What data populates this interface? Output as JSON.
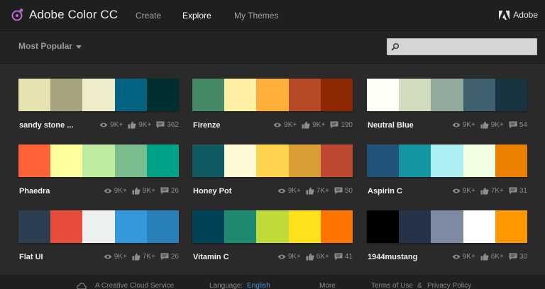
{
  "header": {
    "logo_text": "Adobe Color CC",
    "nav": [
      {
        "label": "Create",
        "active": false
      },
      {
        "label": "Explore",
        "active": true
      },
      {
        "label": "My Themes",
        "active": false
      }
    ],
    "brand_text": "Adobe"
  },
  "toolbar": {
    "filter_label": "Most Popular",
    "search_placeholder": "",
    "search_value": ""
  },
  "themes": [
    {
      "name": "sandy stone ...",
      "views": "9K+",
      "likes": "9K+",
      "comments": "362",
      "colors": [
        "#E6E2AF",
        "#A7A37E",
        "#EFECCA",
        "#046380",
        "#002F2F"
      ]
    },
    {
      "name": "Firenze",
      "views": "9K+",
      "likes": "9K+",
      "comments": "190",
      "colors": [
        "#468966",
        "#FFF0A5",
        "#FFB03B",
        "#B64926",
        "#8E2800"
      ]
    },
    {
      "name": "Neutral Blue",
      "views": "9K+",
      "likes": "9K+",
      "comments": "54",
      "colors": [
        "#FCFFF5",
        "#D1DBBD",
        "#91AA9D",
        "#3E606F",
        "#193441"
      ]
    },
    {
      "name": "Phaedra",
      "views": "9K+",
      "likes": "9K+",
      "comments": "26",
      "colors": [
        "#FF6138",
        "#FFFF9D",
        "#BEEB9F",
        "#79BD8F",
        "#00A388"
      ]
    },
    {
      "name": "Honey Pot",
      "views": "9K+",
      "likes": "7K+",
      "comments": "50",
      "colors": [
        "#105B63",
        "#FFFAD5",
        "#FFD34E",
        "#DB9E36",
        "#BD4932"
      ]
    },
    {
      "name": "Aspirin C",
      "views": "9K+",
      "likes": "7K+",
      "comments": "31",
      "colors": [
        "#225378",
        "#1695A3",
        "#ACF0F2",
        "#F3FFE2",
        "#EB7F00"
      ]
    },
    {
      "name": "Flat UI",
      "views": "9K+",
      "likes": "7K+",
      "comments": "26",
      "colors": [
        "#2C3E50",
        "#E74C3C",
        "#ECF0F1",
        "#3498DB",
        "#2980B9"
      ]
    },
    {
      "name": "Vitamin C",
      "views": "9K+",
      "likes": "6K+",
      "comments": "41",
      "colors": [
        "#004358",
        "#1F8A70",
        "#BEDB39",
        "#FFE11A",
        "#FD7400"
      ]
    },
    {
      "name": "1944mustang",
      "views": "9K+",
      "likes": "6K+",
      "comments": "30",
      "colors": [
        "#000000",
        "#263248",
        "#7E8AA2",
        "#FFFFFF",
        "#FF9800"
      ]
    }
  ],
  "footer": {
    "service": "A Creative Cloud Service",
    "language_label": "Language:",
    "language_value": "English",
    "more": "More",
    "terms": "Terms of Use",
    "amp": "&",
    "privacy": "Privacy Policy"
  }
}
